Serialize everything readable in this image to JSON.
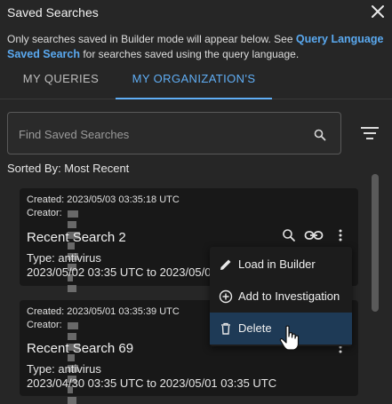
{
  "dialog": {
    "title": "Saved Searches",
    "info_text": "Only searches saved in Builder mode will appear below. See ",
    "info_link": "Query Language Saved Search",
    "info_suffix": " for searches saved using the query language."
  },
  "tabs": [
    {
      "label": "MY QUERIES",
      "active": false
    },
    {
      "label": "MY ORGANIZATION'S",
      "active": true
    }
  ],
  "search": {
    "placeholder": "Find Saved Searches",
    "value": ""
  },
  "sorted_by": "Sorted By: Most Recent",
  "cards": [
    {
      "created": "Created: 2023/05/03 03:35:18 UTC",
      "creator_label": "Creator:",
      "title": "Recent Search 2",
      "type": "Type: antivirus",
      "range": "2023/05/02 03:35 UTC to 2023/05/03 03:35 UTC"
    },
    {
      "created": "Created: 2023/05/01 03:35:39 UTC",
      "creator_label": "Creator:",
      "title": "Recent Search 69",
      "type": "Type: antivirus",
      "range": "2023/04/30 03:35 UTC to 2023/05/01 03:35 UTC"
    }
  ],
  "menu": {
    "items": [
      {
        "label": "Load in Builder",
        "icon": "pencil-icon"
      },
      {
        "label": "Add to Investigation",
        "icon": "plus-circle-icon"
      },
      {
        "label": "Delete",
        "icon": "trash-icon",
        "hovered": true
      }
    ]
  },
  "colors": {
    "accent": "#60aef5",
    "background": "#262626",
    "card": "#181818",
    "menu_hover": "#1e3a56"
  }
}
